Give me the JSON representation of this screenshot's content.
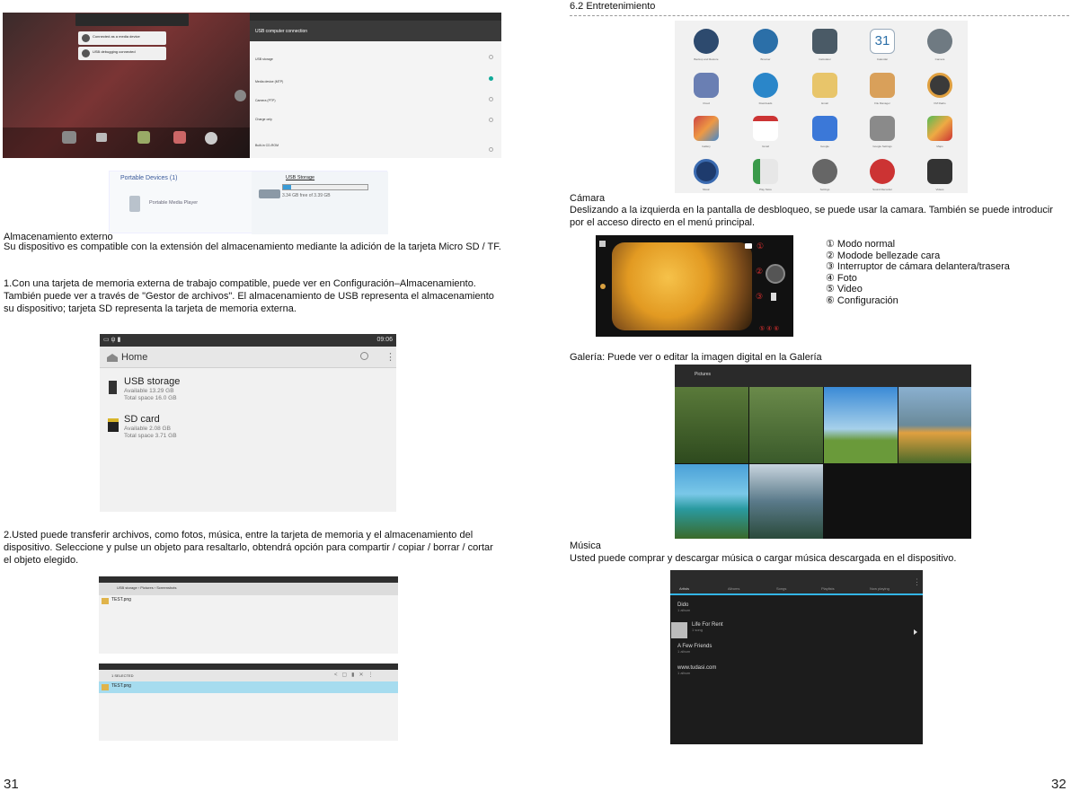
{
  "left": {
    "usb_notice_title": "USB computer connection",
    "usb_options": [
      "USB storage",
      "Media device (MTP)",
      "Camera (PTP)",
      "Charge only",
      "Built-in CD-ROM"
    ],
    "notifications": [
      "Connected as a media device",
      "USB debugging connected"
    ],
    "portable_devices": "Portable Devices (1)",
    "device_name": "Portable Media Player",
    "usb_storage_label": "USB Storage",
    "usb_free": "3.34 GB free of 3.39 GB",
    "section_title": "Almacenamiento externo",
    "para1": "Su dispositivo es compatible con la extensión del almacenamiento mediante la adición de la tarjeta Micro SD / TF.",
    "para2": "1.Con una tarjeta de memoria externa de trabajo compatible, puede ver en Configuración–Almacenamiento. También puede ver a través de \"Gestor de archivos\". El almacenamiento de USB representa el almacenamiento su dispositivo; tarjeta SD representa la tarjeta de memoria externa.",
    "fm": {
      "time": "09:06",
      "home": "Home",
      "usb_title": "USB storage",
      "usb_avail": "Available 13.29 GB",
      "usb_total": "Total space 16.0 GB",
      "sd_title": "SD card",
      "sd_avail": "Available 2.08 GB",
      "sd_total": "Total space 3.71 GB"
    },
    "para3": "2.Usted puede transferir archivos, como fotos, música, entre la tarjeta de memoria y el almacenamiento del dispositivo. Seleccione y pulse un objeto para resaltarlo, obtendrá opción para compartir / copiar / borrar / cortar el objeto elegido.",
    "fm2": {
      "crumbs": [
        "USB storage",
        "Pictures",
        "Screenshots"
      ],
      "file": "TEST.png",
      "selected": "1 SELECTED"
    },
    "page_number": "31"
  },
  "right": {
    "section_title": "6.2 Entretenimiento",
    "apps": [
      "Backup and Restore",
      "Browser",
      "Calculator",
      "Calendar",
      "Camera",
      "Cloud",
      "Downloads",
      "Email",
      "File Manager",
      "FM Radio",
      "Gallery",
      "Gmail",
      "Google",
      "Google Settings",
      "Maps",
      "Music",
      "Play Store",
      "Settings",
      "Sound Recorder",
      "Videos"
    ],
    "calendar_day": "31",
    "camera_title": "Cámara",
    "camera_text": "Deslizando a la izquierda en la pantalla de desbloqueo, se puede usar la camara. También se puede introducir por el acceso directo en el menú principal.",
    "camera_legend": [
      "① Modo normal",
      "② Modode bellezade cara",
      "③ Interruptor de cámara delantera/trasera",
      "④ Foto",
      "⑤ Video",
      "⑥ Configuración"
    ],
    "camera_markers": [
      "①",
      "②",
      "③",
      "④",
      "⑤",
      "⑥"
    ],
    "gallery_text": "Galería: Puede ver o editar la imagen digital en la Galería",
    "gallery_header": "Pictures",
    "music_title": "Música",
    "music_text": "Usted puede comprar y descargar música o cargar música descargada en el dispositivo.",
    "music_tabs": [
      "Artists",
      "Albums",
      "Songs",
      "Playlists",
      "Now playing"
    ],
    "music_items": [
      {
        "title": "Dido",
        "sub": "1 album"
      },
      {
        "title": "Life For Rent",
        "sub": "1 song"
      },
      {
        "title": "A Few Friends",
        "sub": "1 album"
      },
      {
        "title": "www.tudasi.com",
        "sub": "1 album"
      }
    ],
    "page_number": "32"
  },
  "colors": {
    "accent_blue": "#33b5e5",
    "selected_row": "#a6dcef",
    "marker_red": "#d93030"
  }
}
